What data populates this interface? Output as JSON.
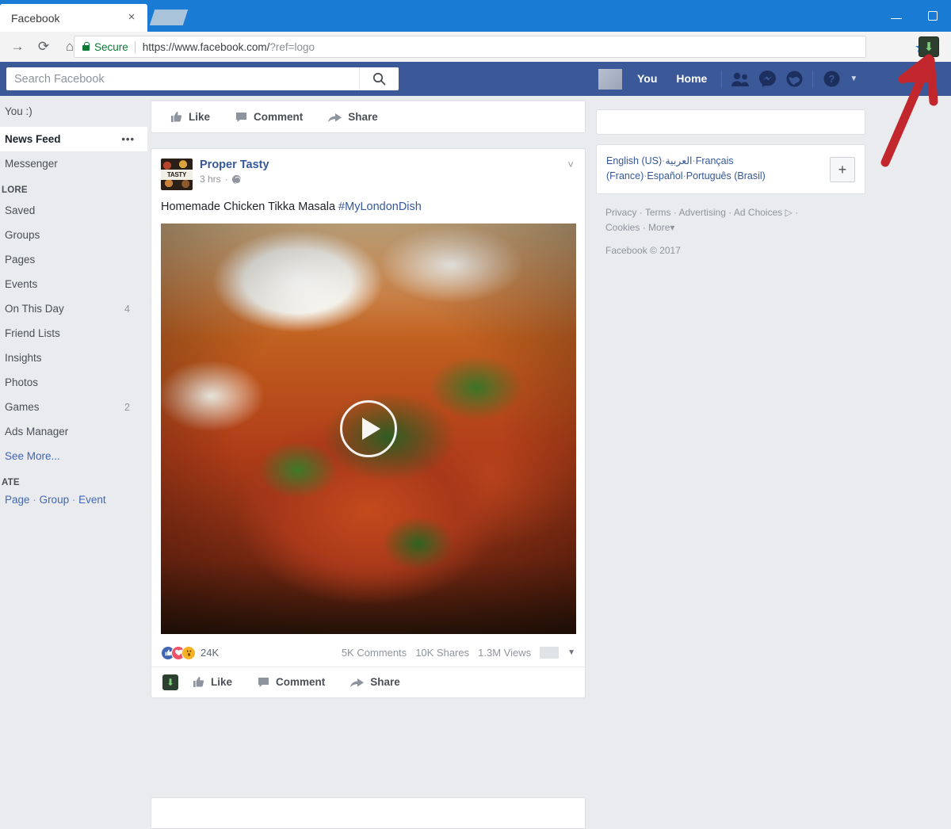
{
  "browser": {
    "tab_title": "Facebook",
    "close_label": "×",
    "forward_icon": "→",
    "reload_icon": "⟳",
    "home_icon": "⌂",
    "secure_label": "Secure",
    "url_main": "https://www.facebook.com/",
    "url_query": "?ref=logo",
    "star_icon": "★",
    "extension_icon": "⬇",
    "minimize_label": "",
    "maximize_label": ""
  },
  "topnav": {
    "search_placeholder": "Search Facebook",
    "search_value": "",
    "search_icon": "⌕",
    "you_label": "You",
    "home_label": "Home",
    "friends_icon": "friends",
    "messenger_icon": "messenger",
    "globe_icon": "globe",
    "help_icon": "?",
    "caret_icon": "▼"
  },
  "sidebar": {
    "profile_label": "You :)",
    "items": [
      {
        "label": "News Feed",
        "count": "",
        "active": true,
        "dots": "•••"
      },
      {
        "label": "Messenger",
        "count": "",
        "active": false,
        "dots": ""
      }
    ],
    "explore_heading": "LORE",
    "explore_items": [
      {
        "label": "Saved",
        "count": ""
      },
      {
        "label": "Groups",
        "count": ""
      },
      {
        "label": "Pages",
        "count": ""
      },
      {
        "label": "Events",
        "count": ""
      },
      {
        "label": "On This Day",
        "count": "4"
      },
      {
        "label": "Friend Lists",
        "count": ""
      },
      {
        "label": "Insights",
        "count": ""
      },
      {
        "label": "Photos",
        "count": ""
      },
      {
        "label": "Games",
        "count": "2"
      },
      {
        "label": "Ads Manager",
        "count": ""
      }
    ],
    "see_more": "See More...",
    "create_heading": "ATE",
    "create_links": [
      "Page",
      "Group",
      "Event"
    ],
    "create_separator": "·"
  },
  "feed": {
    "partial_post": {
      "like_label": "Like",
      "comment_label": "Comment",
      "share_label": "Share"
    },
    "post": {
      "author": "Proper Tasty",
      "timestamp": "3 hrs",
      "privacy_icon": "globe",
      "meta_separator": "·",
      "chevron_icon": "˅",
      "text": "Homemade Chicken Tikka Masala ",
      "hashtag": "#MyLondonDish",
      "media_type": "video",
      "play_icon": "▶",
      "reactions": {
        "like_icon": "👍",
        "love_icon": "❤",
        "wow_icon": "😮",
        "count": "24K"
      },
      "stats": {
        "comments": "5K Comments",
        "shares": "10K Shares",
        "views": "1.3M Views",
        "caret": "▼"
      },
      "actions": {
        "download_icon": "⬇",
        "like_label": "Like",
        "comment_label": "Comment",
        "share_label": "Share"
      }
    }
  },
  "rightcol": {
    "languages": [
      "English (US)",
      "العربية",
      "Français (France)",
      "Español",
      "Português (Brasil)"
    ],
    "lang_separator": "·",
    "add_language_label": "+",
    "footer_links": [
      "Privacy",
      "Terms",
      "Advertising",
      "Ad Choices",
      "Cookies",
      "More"
    ],
    "ad_choices_icon": "▷",
    "more_caret": "▾",
    "copyright": "Facebook © 2017"
  },
  "annotation": {
    "arrow_color": "#c1272d",
    "arrow_target": "extension-icon"
  }
}
